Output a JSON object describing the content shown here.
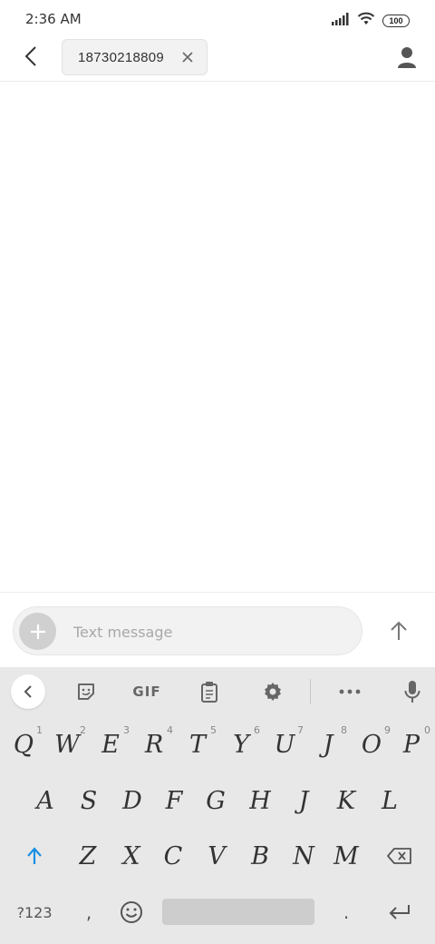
{
  "status": {
    "time": "2:36 AM",
    "battery": "100"
  },
  "header": {
    "recipient": "18730218809"
  },
  "compose": {
    "placeholder": "Text message"
  },
  "keyboard": {
    "toolbar": {
      "gif_label": "GIF"
    },
    "rows": [
      [
        {
          "label": "Q",
          "hint": "1"
        },
        {
          "label": "W",
          "hint": "2"
        },
        {
          "label": "E",
          "hint": "3"
        },
        {
          "label": "R",
          "hint": "4"
        },
        {
          "label": "T",
          "hint": "5"
        },
        {
          "label": "Y",
          "hint": "6"
        },
        {
          "label": "U",
          "hint": "7"
        },
        {
          "label": "J",
          "hint": "8"
        },
        {
          "label": "O",
          "hint": "9"
        },
        {
          "label": "P",
          "hint": "0"
        }
      ],
      [
        {
          "label": "A"
        },
        {
          "label": "S"
        },
        {
          "label": "D"
        },
        {
          "label": "F"
        },
        {
          "label": "G"
        },
        {
          "label": "H"
        },
        {
          "label": "J"
        },
        {
          "label": "K"
        },
        {
          "label": "L"
        }
      ],
      [
        {
          "label": "Z"
        },
        {
          "label": "X"
        },
        {
          "label": "C"
        },
        {
          "label": "V"
        },
        {
          "label": "B"
        },
        {
          "label": "N"
        },
        {
          "label": "M"
        }
      ]
    ],
    "bottom": {
      "symbols_label": "?123",
      "comma_label": ",",
      "period_label": "."
    }
  },
  "colors": {
    "accent": "#1a8fe3",
    "key_text": "#333333",
    "keyboard_bg": "#e8e8e8"
  },
  "icons": [
    "back-arrow-icon",
    "close-icon",
    "contact-icon",
    "plus-icon",
    "send-arrow-icon",
    "chevron-left-icon",
    "sticker-icon",
    "clipboard-icon",
    "gear-icon",
    "more-icon",
    "microphone-icon",
    "shift-arrow-icon",
    "backspace-icon",
    "emoji-icon",
    "enter-icon"
  ]
}
